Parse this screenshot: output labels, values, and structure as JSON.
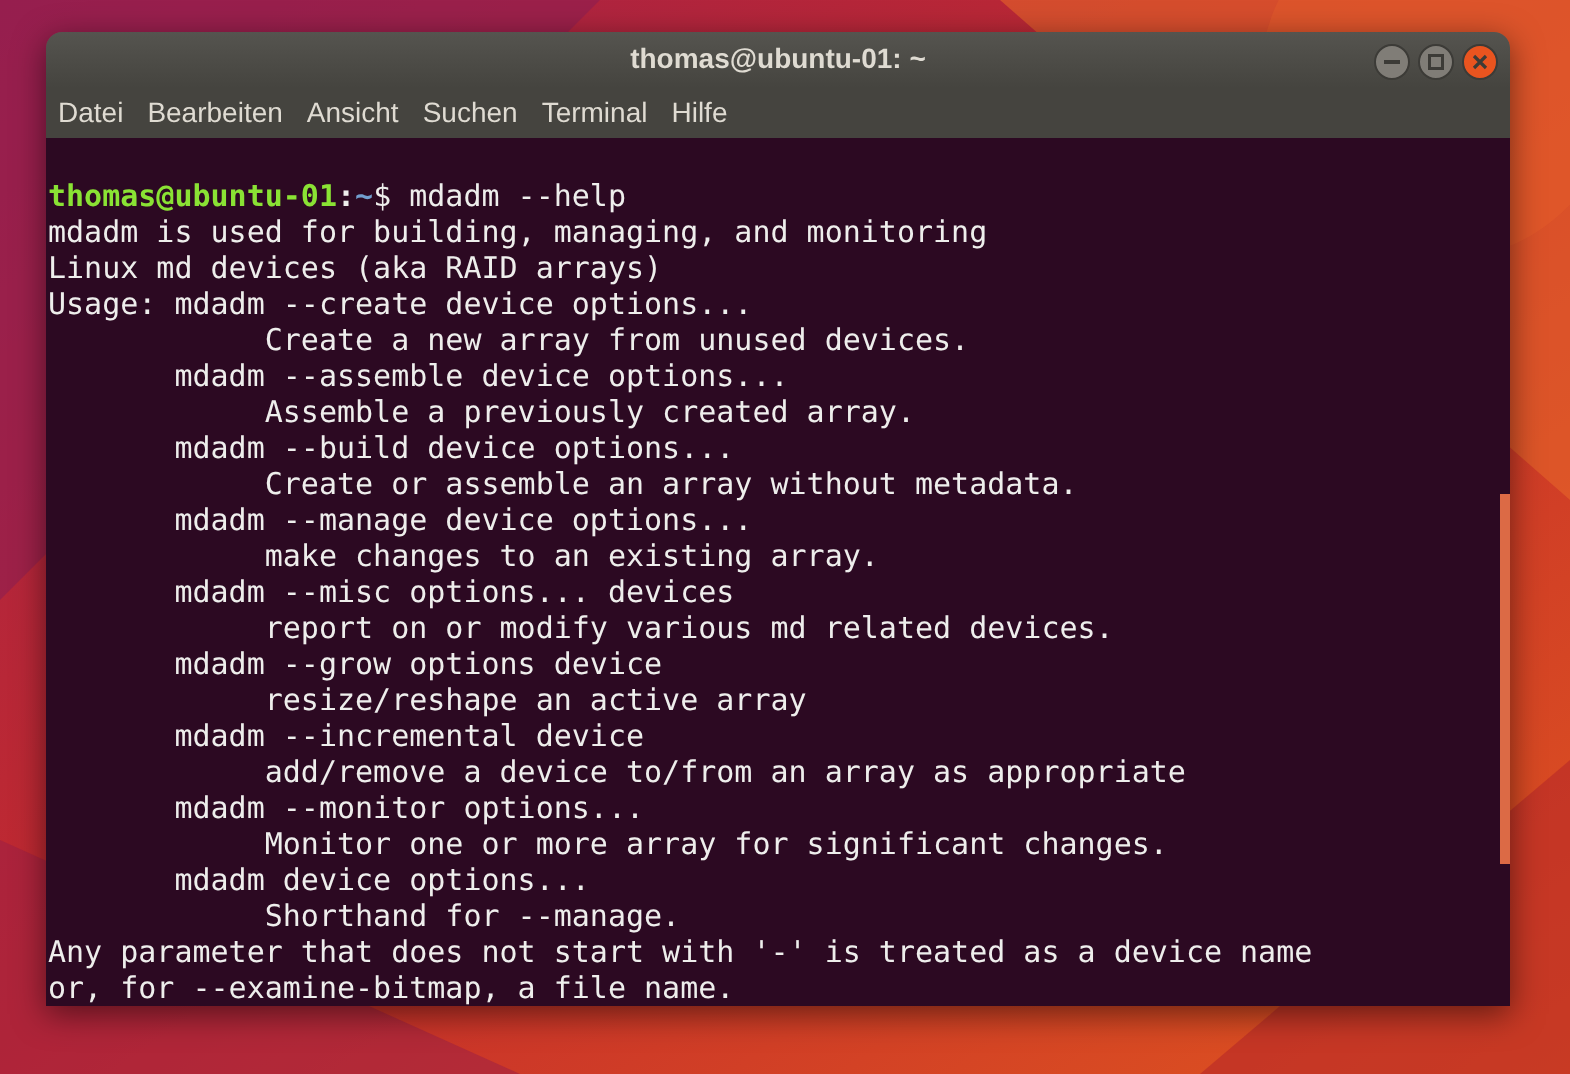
{
  "window": {
    "title": "thomas@ubuntu-01: ~"
  },
  "menu": [
    "Datei",
    "Bearbeiten",
    "Ansicht",
    "Suchen",
    "Terminal",
    "Hilfe"
  ],
  "terminal": {
    "lines": [
      {
        "kind": "prompt",
        "user": "thomas@ubuntu-01",
        "separator": ":",
        "path": "~",
        "command": "$ mdadm --help"
      },
      {
        "kind": "output",
        "text": "mdadm is used for building, managing, and monitoring"
      },
      {
        "kind": "output",
        "text": "Linux md devices (aka RAID arrays)"
      },
      {
        "kind": "output",
        "text": "Usage: mdadm --create device options..."
      },
      {
        "kind": "output",
        "text": "            Create a new array from unused devices."
      },
      {
        "kind": "output",
        "text": "       mdadm --assemble device options..."
      },
      {
        "kind": "output",
        "text": "            Assemble a previously created array."
      },
      {
        "kind": "output",
        "text": "       mdadm --build device options..."
      },
      {
        "kind": "output",
        "text": "            Create or assemble an array without metadata."
      },
      {
        "kind": "output",
        "text": "       mdadm --manage device options..."
      },
      {
        "kind": "output",
        "text": "            make changes to an existing array."
      },
      {
        "kind": "output",
        "text": "       mdadm --misc options... devices"
      },
      {
        "kind": "output",
        "text": "            report on or modify various md related devices."
      },
      {
        "kind": "output",
        "text": "       mdadm --grow options device"
      },
      {
        "kind": "output",
        "text": "            resize/reshape an active array"
      },
      {
        "kind": "output",
        "text": "       mdadm --incremental device"
      },
      {
        "kind": "output",
        "text": "            add/remove a device to/from an array as appropriate"
      },
      {
        "kind": "output",
        "text": "       mdadm --monitor options..."
      },
      {
        "kind": "output",
        "text": "            Monitor one or more array for significant changes."
      },
      {
        "kind": "output",
        "text": "       mdadm device options..."
      },
      {
        "kind": "output",
        "text": "            Shorthand for --manage."
      },
      {
        "kind": "output",
        "text": "Any parameter that does not start with '-' is treated as a device name"
      },
      {
        "kind": "output",
        "text": "or, for --examine-bitmap, a file name."
      }
    ]
  }
}
